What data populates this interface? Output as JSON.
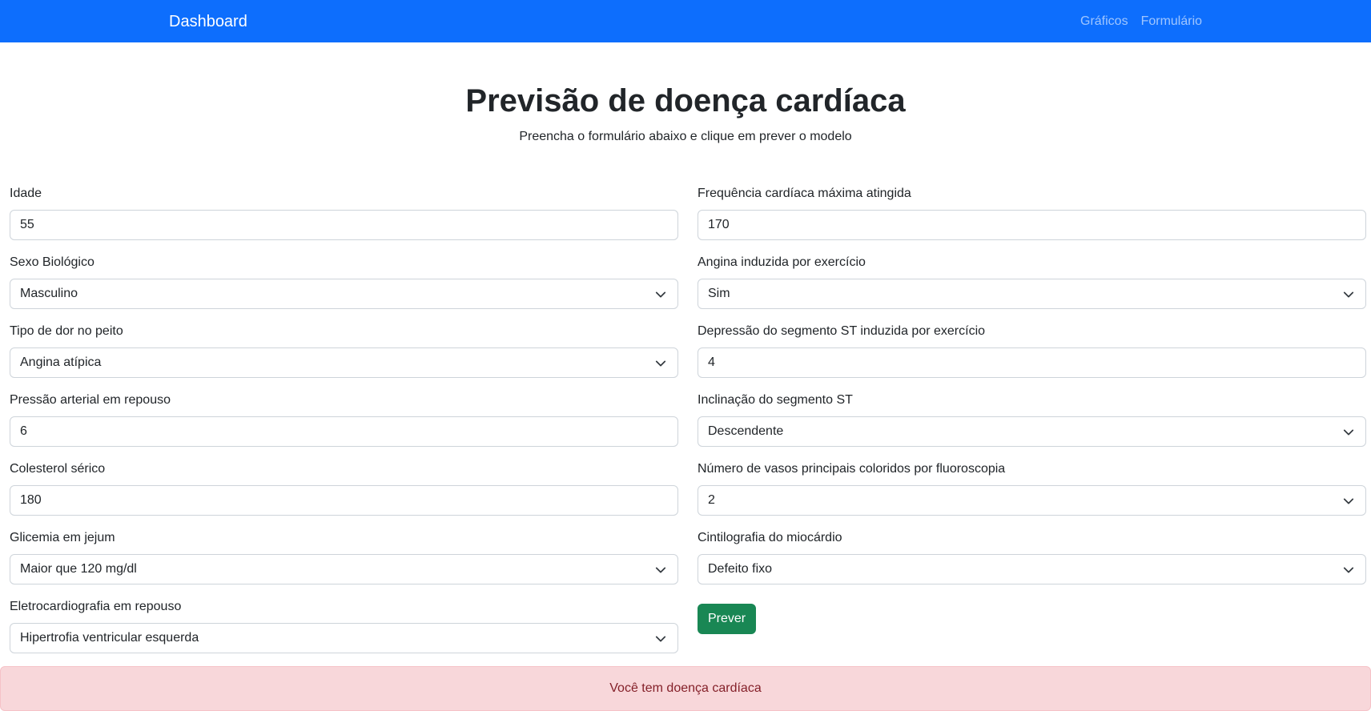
{
  "navbar": {
    "brand": "Dashboard",
    "links": [
      "Gráficos",
      "Formulário"
    ],
    "background": "#0d6efd"
  },
  "header": {
    "title": "Previsão de doença cardíaca",
    "subtitle": "Preencha o formulário abaixo e clique em prever o modelo"
  },
  "form": {
    "left": [
      {
        "label": "Idade",
        "type": "input",
        "value": "55"
      },
      {
        "label": "Sexo Biológico",
        "type": "select",
        "value": "Masculino"
      },
      {
        "label": "Tipo de dor no peito",
        "type": "select",
        "value": "Angina atípica"
      },
      {
        "label": "Pressão arterial em repouso",
        "type": "input",
        "value": "6"
      },
      {
        "label": "Colesterol sérico",
        "type": "input",
        "value": "180"
      },
      {
        "label": "Glicemia em jejum",
        "type": "select",
        "value": "Maior que 120 mg/dl"
      },
      {
        "label": "Eletrocardiografia em repouso",
        "type": "select",
        "value": "Hipertrofia ventricular esquerda"
      }
    ],
    "right": [
      {
        "label": "Frequência cardíaca máxima atingida",
        "type": "input",
        "value": "170"
      },
      {
        "label": "Angina induzida por exercício",
        "type": "select",
        "value": "Sim"
      },
      {
        "label": "Depressão do segmento ST induzida por exercício",
        "type": "input",
        "value": "4"
      },
      {
        "label": "Inclinação do segmento ST",
        "type": "select",
        "value": "Descendente"
      },
      {
        "label": "Número de vasos principais coloridos por fluoroscopia",
        "type": "select",
        "value": "2"
      },
      {
        "label": "Cintilografia do miocárdio",
        "type": "select",
        "value": "Defeito fixo"
      }
    ],
    "submit_label": "Prever",
    "submit_color": "#198754"
  },
  "result": {
    "message": "Você tem doença cardíaca",
    "background": "#f8d7da",
    "text_color": "#842029"
  }
}
